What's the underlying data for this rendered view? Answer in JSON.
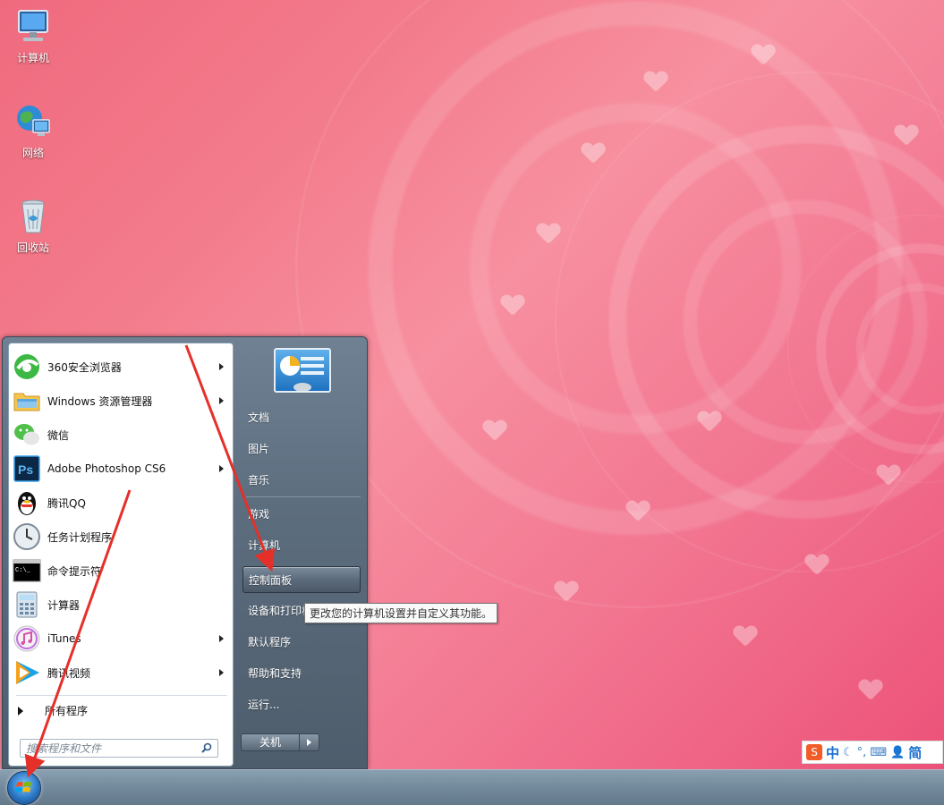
{
  "desktop": {
    "icons": [
      {
        "label": "计算机",
        "icon": "computer-icon"
      },
      {
        "label": "网络",
        "icon": "network-icon"
      },
      {
        "label": "回收站",
        "icon": "recycle-bin-icon"
      }
    ]
  },
  "start_menu": {
    "programs": [
      {
        "label": "360安全浏览器",
        "icon": "360-browser-icon",
        "has_submenu": true
      },
      {
        "label": "Windows 资源管理器",
        "icon": "explorer-folder-icon",
        "has_submenu": true
      },
      {
        "label": "微信",
        "icon": "wechat-icon",
        "has_submenu": false
      },
      {
        "label": "Adobe Photoshop CS6",
        "icon": "photoshop-icon",
        "has_submenu": true
      },
      {
        "label": "腾讯QQ",
        "icon": "qq-penguin-icon",
        "has_submenu": false
      },
      {
        "label": "任务计划程序",
        "icon": "task-scheduler-clock-icon",
        "has_submenu": false
      },
      {
        "label": "命令提示符",
        "icon": "command-prompt-icon",
        "has_submenu": false
      },
      {
        "label": "计算器",
        "icon": "calculator-icon",
        "has_submenu": false
      },
      {
        "label": "iTunes",
        "icon": "itunes-icon",
        "has_submenu": true
      },
      {
        "label": "腾讯视频",
        "icon": "tencent-video-icon",
        "has_submenu": true
      }
    ],
    "all_programs": "所有程序",
    "search_placeholder": "搜索程序和文件",
    "right_items": [
      {
        "label": "文档"
      },
      {
        "label": "图片"
      },
      {
        "label": "音乐"
      },
      {
        "label": "游戏"
      },
      {
        "label": "计算机"
      },
      {
        "label": "控制面板",
        "highlighted": true
      },
      {
        "label": "设备和打印机"
      },
      {
        "label": "默认程序"
      },
      {
        "label": "帮助和支持"
      },
      {
        "label": "运行..."
      }
    ],
    "shutdown_label": "关机",
    "tooltip": "更改您的计算机设置并自定义其功能。"
  },
  "ime_bar": {
    "mode": "中",
    "script": "简"
  },
  "colors": {
    "annotation_arrow": "#e5302a",
    "wallpaper": "#f27590"
  }
}
